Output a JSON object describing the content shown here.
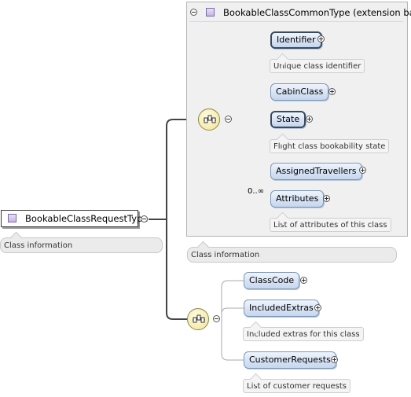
{
  "root": {
    "name": "BookableClassRequestType",
    "annotation": "Class information"
  },
  "extension": {
    "base_label": "BookableClassCommonType (extension base)",
    "annotation": "Class information",
    "children": [
      {
        "name": "Identifier",
        "annotation": "Unique class identifier"
      },
      {
        "name": "CabinClass"
      },
      {
        "name": "State",
        "annotation": "Flight class bookability state"
      },
      {
        "name": "AssignedTravellers"
      },
      {
        "name": "Attributes",
        "occurrence": "0..∞",
        "annotation": "List of attributes of this class"
      }
    ]
  },
  "sequence2": {
    "children": [
      {
        "name": "ClassCode"
      },
      {
        "name": "IncludedExtras",
        "annotation": "Included extras for this class"
      },
      {
        "name": "CustomerRequests",
        "annotation": "List of customer requests"
      }
    ]
  },
  "colors": {
    "element_fill": "#c5d6ee",
    "element_border": "#7f98b8",
    "sequence_fill": "#f1e49a",
    "extension_box": "#f0f0f0",
    "type_icon": "#c6b6e4"
  },
  "icons": {
    "sequence": "sequence-compositor-icon",
    "type": "complex-type-icon",
    "expand": "plus-circle-icon",
    "collapse": "minus-circle-icon"
  }
}
